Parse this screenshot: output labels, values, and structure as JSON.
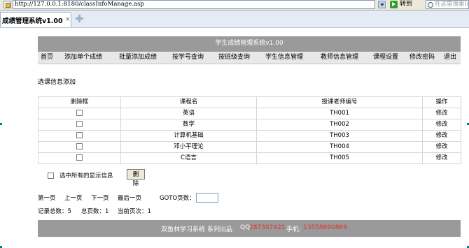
{
  "browser": {
    "address": "http://127.0.0.1:8180/classInfoManage.asp",
    "go_label": "转到",
    "search_placeholder": "在这里搜索(Al",
    "tab_title": "成绩管理系统v1.00",
    "tab_close": "×"
  },
  "app": {
    "title": "学生成绩管理系统v1.00",
    "nav": [
      "首页",
      "添加单个成绩",
      "批量添加成绩",
      "按学号查询",
      "按班级查询",
      "学生信息管理",
      "教师信息管理",
      "课程设置",
      "修改密码",
      "退出"
    ]
  },
  "section_label": "选课信息添加",
  "table": {
    "headers": [
      "删除框",
      "课程名",
      "授课老师编号",
      "操作"
    ],
    "rows": [
      {
        "course": "英语",
        "teacher_id": "TH001",
        "action": "修改"
      },
      {
        "course": "数学",
        "teacher_id": "TH002",
        "action": "修改"
      },
      {
        "course": "计算机基础",
        "teacher_id": "TH003",
        "action": "修改"
      },
      {
        "course": "邓小平理论",
        "teacher_id": "TH004",
        "action": "修改"
      },
      {
        "course": "C语言",
        "teacher_id": "TH005",
        "action": "修改"
      }
    ]
  },
  "select_all_label": "选中所有的显示信息",
  "delete_label": "删除",
  "pager": {
    "first": "第一页",
    "prev": "上一页",
    "next": "下一页",
    "last": "最后一页",
    "goto_label": "GOTO页数："
  },
  "stats": {
    "total_records": "记录总数：5",
    "total_pages": "总页数：1",
    "current_page": "当前页次：1"
  },
  "footer": {
    "brand": "双鱼林学习系统",
    "made_by": "系列出品",
    "qq_label": "QQ:",
    "qq_value": "287307421",
    "phone_label": "手机:",
    "phone_value": "13558690869"
  },
  "colors": {
    "header_bg": "#9a9a9a",
    "nav_bg": "#e8e8e8",
    "footer_accent": "#e03030"
  }
}
